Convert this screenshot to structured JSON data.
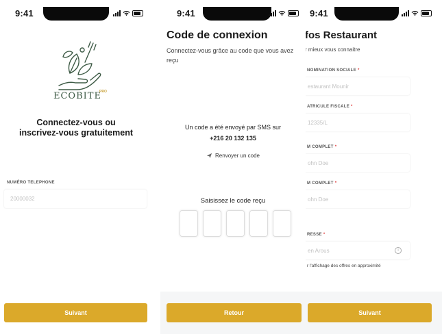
{
  "screens": {
    "login": {
      "status_time": "9:41",
      "brand_name": "ECOBITE",
      "brand_suffix": "PRO",
      "heading_line1": "Connectez-vous ou",
      "heading_line2": "inscrivez-vous gratuitement",
      "phone_label": "NUMÉRO TELEPHONE",
      "phone_placeholder": "20000032",
      "next_button": "Suivant"
    },
    "code": {
      "status_time": "9:41",
      "title": "Code de connexion",
      "subtitle": "Connectez-vous grâce au code que vous avez reçu",
      "sent_message": "Un code a été envoyé par SMS sur",
      "phone_number": "+216 20 132 135",
      "resend_link": "Renvoyer un code",
      "code_label": "Saisissez le code reçu",
      "back_button": "Retour"
    },
    "restaurant": {
      "status_time": "9:41",
      "title": "fos Restaurant",
      "subtitle": "r mieux vous connaitre",
      "fields": [
        {
          "label": "NOMINATION SOCIALE",
          "placeholder": "estaurant Mounir"
        },
        {
          "label": "ATRICULE FISCALE",
          "placeholder": "12335/L"
        },
        {
          "label": "M COMPLET",
          "placeholder": "ohn Doe"
        },
        {
          "label": "M COMPLET",
          "placeholder": "ohn Doe"
        },
        {
          "label": "RESSE",
          "placeholder": "en Arous"
        }
      ],
      "address_note": "r l'affichage des offres en approximité",
      "next_button": "Suivant"
    }
  },
  "colors": {
    "accent": "#dba92a",
    "brand_green": "#3d5a45",
    "required": "#e03b3b"
  }
}
